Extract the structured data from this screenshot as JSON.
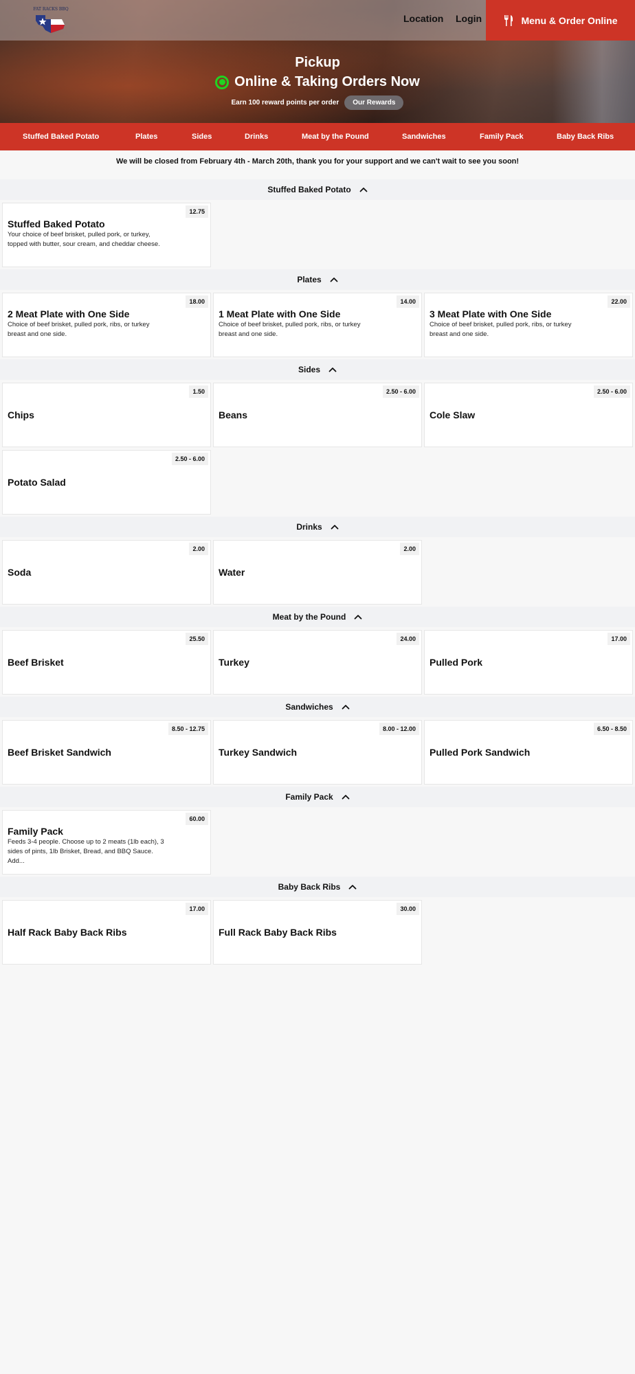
{
  "header": {
    "logo_text": "FAT RACKS BBQ",
    "location_label": "Location",
    "login_label": "Login",
    "order_button_label": "Menu & Order Online"
  },
  "hero": {
    "title": "Pickup",
    "status": "Online & Taking Orders Now",
    "rewards_text": "Earn 100 reward points per order",
    "rewards_button": "Our Rewards"
  },
  "categories": [
    "Stuffed Baked Potato",
    "Plates",
    "Sides",
    "Drinks",
    "Meat by the Pound",
    "Sandwiches",
    "Family Pack",
    "Baby Back Ribs"
  ],
  "notice": "We will be closed from February 4th - March 20th, thank you for your support and we can't wait to see you soon!",
  "sections": [
    {
      "title": "Stuffed Baked Potato",
      "items": [
        {
          "name": "Stuffed Baked Potato",
          "price": "12.75",
          "desc": "Your choice of beef brisket, pulled pork, or turkey, topped with butter, sour cream, and cheddar cheese."
        }
      ]
    },
    {
      "title": "Plates",
      "items": [
        {
          "name": "2 Meat Plate with One Side",
          "price": "18.00",
          "desc": "Choice of beef brisket, pulled pork, ribs, or turkey breast and one side."
        },
        {
          "name": "1 Meat Plate with One Side",
          "price": "14.00",
          "desc": "Choice of beef brisket, pulled pork, ribs, or turkey breast and one side."
        },
        {
          "name": "3 Meat Plate with One Side",
          "price": "22.00",
          "desc": "Choice of beef brisket, pulled pork, ribs, or turkey breast and one side."
        }
      ]
    },
    {
      "title": "Sides",
      "items": [
        {
          "name": "Chips",
          "price": "1.50"
        },
        {
          "name": "Beans",
          "price": "2.50 - 6.00"
        },
        {
          "name": "Cole Slaw",
          "price": "2.50 - 6.00"
        },
        {
          "name": "Potato Salad",
          "price": "2.50 - 6.00"
        }
      ]
    },
    {
      "title": "Drinks",
      "items": [
        {
          "name": "Soda",
          "price": "2.00"
        },
        {
          "name": "Water",
          "price": "2.00"
        }
      ]
    },
    {
      "title": "Meat by the Pound",
      "items": [
        {
          "name": "Beef Brisket",
          "price": "25.50"
        },
        {
          "name": "Turkey",
          "price": "24.00"
        },
        {
          "name": "Pulled Pork",
          "price": "17.00"
        }
      ]
    },
    {
      "title": "Sandwiches",
      "items": [
        {
          "name": "Beef Brisket Sandwich",
          "price": "8.50 - 12.75"
        },
        {
          "name": "Turkey Sandwich",
          "price": "8.00 - 12.00"
        },
        {
          "name": "Pulled Pork Sandwich",
          "price": "6.50 - 8.50"
        }
      ]
    },
    {
      "title": "Family Pack",
      "items": [
        {
          "name": "Family Pack",
          "price": "60.00",
          "desc": "Feeds 3-4 people. Choose up to 2 meats (1lb each), 3 sides of pints, 1lb Brisket, Bread, and BBQ Sauce. Add..."
        }
      ]
    },
    {
      "title": "Baby Back Ribs",
      "items": [
        {
          "name": "Half Rack Baby Back Ribs",
          "price": "17.00"
        },
        {
          "name": "Full Rack Baby Back Ribs",
          "price": "30.00"
        }
      ]
    }
  ],
  "colors": {
    "accent": "#cd3426",
    "status_green": "#21d321"
  }
}
